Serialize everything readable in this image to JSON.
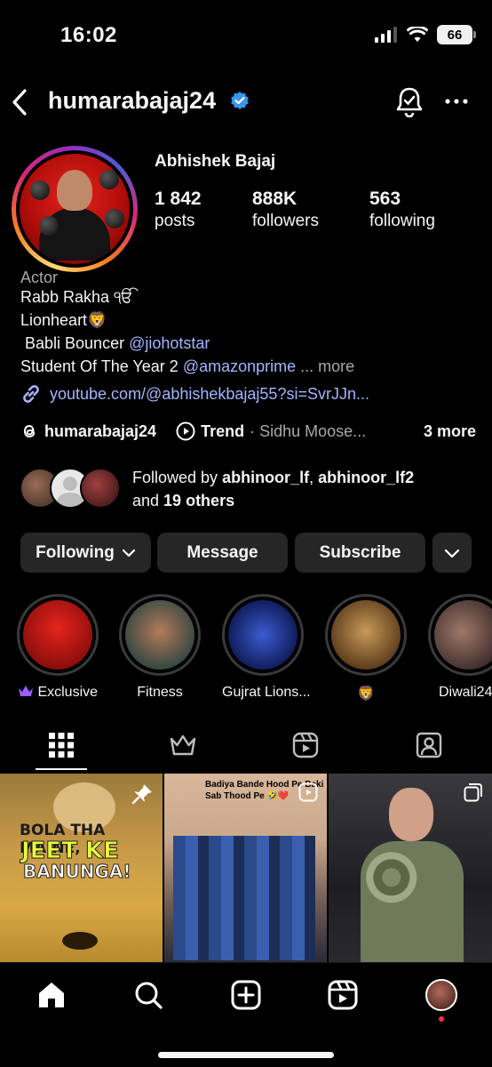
{
  "status_bar": {
    "time": "16:02",
    "battery": "66"
  },
  "header": {
    "username": "humarabajaj24"
  },
  "profile": {
    "display_name": "Abhishek Bajaj",
    "stats": [
      {
        "value": "1 842",
        "label": "posts"
      },
      {
        "value": "888K",
        "label": "followers"
      },
      {
        "value": "563",
        "label": "following"
      }
    ],
    "bio": {
      "category": "Actor",
      "line1": "Rabb Rakha ੴ",
      "line2": "Lionheart🦁",
      "line3_prefix": " Babli Bouncer ",
      "line3_mention": "@jiohotstar",
      "line4_prefix": "Student Of The Year 2 ",
      "line4_mention": "@amazonprime",
      "line4_more": " ... more"
    },
    "link": "youtube.com/@abhishekbajaj55?si=SvrJJn...",
    "threads_handle": "humarabajaj24",
    "trend_label": "Trend",
    "trend_text": "· Sidhu Moose...",
    "more_count": "3 more",
    "followed_by": {
      "prefix": "Followed by ",
      "user1": "abhinoor_lf",
      "sep": ", ",
      "user2": "abhinoor_lf2",
      "and": "and ",
      "others": "19 others"
    }
  },
  "actions": {
    "following": "Following",
    "message": "Message",
    "subscribe": "Subscribe"
  },
  "highlights": [
    {
      "label": "Exclusive"
    },
    {
      "label": "Fitness"
    },
    {
      "label": "Gujrat Lions..."
    },
    {
      "label": "🦁"
    },
    {
      "label": "Diwali24"
    }
  ],
  "posts": [
    {
      "overlay_line1": "BOLA THA MAINE,",
      "overlay_line2": "JEET KE",
      "overlay_line3": "BANUNGA!"
    },
    {
      "caption_line1": "Badiya Bande Hood Pe Baki",
      "caption_line2": "Sab Thood Pe 🤣❤️"
    },
    {}
  ],
  "colors": {
    "accent_link": "#a5b4ff",
    "verified": "#3897f0",
    "button_bg": "#262626"
  }
}
